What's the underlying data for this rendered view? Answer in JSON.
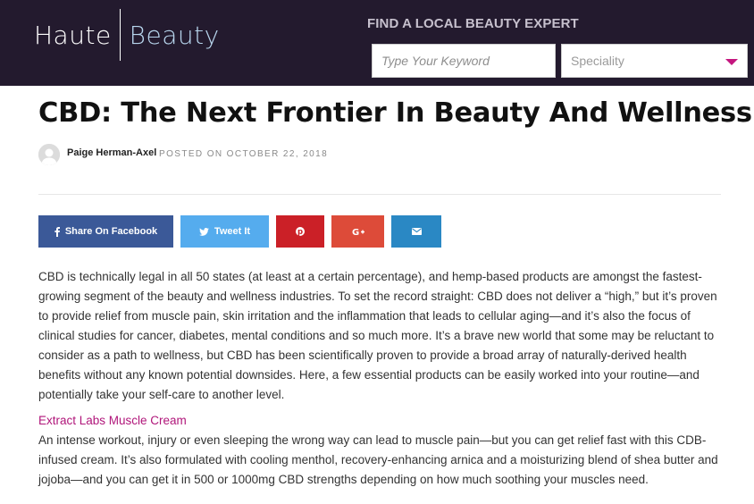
{
  "header": {
    "logo_left": "Haute",
    "logo_right": "Beauty",
    "find_label": "FIND A LOCAL BEAUTY EXPERT",
    "keyword_placeholder": "Type Your Keyword",
    "speciality_value": "Speciality",
    "accent_color": "#c4167f"
  },
  "article": {
    "title": "CBD: The Next Frontier In Beauty And Wellness",
    "author": "Paige Herman-Axel",
    "posted": "POSTED ON OCTOBER 22, 2018",
    "intro": "CBD is technically legal in all 50 states (at least at a certain percentage), and hemp-based products are amongst the fastest-growing segment of the beauty and wellness industries. To set the record straight: CBD does not deliver a “high,” but it’s proven to provide relief from muscle pain, skin irritation and the inflammation that leads to cellular aging—and it’s also the focus of clinical studies for cancer, diabetes, mental conditions and so much more. It’s a brave new world that some may be reluctant to consider as a path to wellness, but CBD has been scientifically proven to provide a broad array of naturally-derived health benefits without any known potential downsides. Here, a few essential products can be easily worked into your routine—and potentially take your self-care to another level.",
    "product_link": "Extract Labs Muscle Cream",
    "product_text": "An intense workout, injury or even sleeping the wrong way can lead to muscle pain—but you can get relief fast with this CDB-infused cream. It’s also formulated with cooling menthol, recovery-enhancing arnica and a moisturizing blend of shea butter and jojoba—and you can get it in 500 or 1000mg CBD strengths depending on how much soothing your muscles need."
  },
  "share": {
    "facebook_label": "Share On Facebook",
    "twitter_label": "Tweet It",
    "icons": [
      "facebook-icon",
      "twitter-icon",
      "pinterest-icon",
      "google-plus-icon",
      "envelope-icon"
    ],
    "colors": {
      "facebook": "#3b5998",
      "twitter": "#55acee",
      "pinterest": "#cb2027",
      "google_plus": "#dd4b39",
      "email": "#2a88c4"
    }
  }
}
